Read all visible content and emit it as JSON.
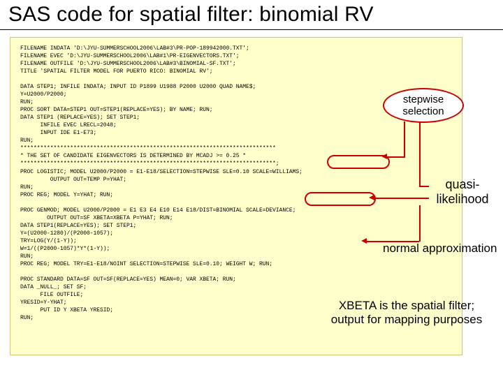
{
  "title": "SAS code for spatial filter: binomial RV",
  "code": "FILENAME INDATA 'D:\\JYU-SUMMERSCHOOL2006\\LAB#3\\PR-POP-189942000.TXT';\nFILENAME EVEC 'D:\\JYU-SUMMERSCHOOL2006\\LAB#1\\PR-EIGENVECTORS.TXT';\nFILENAME OUTFILE 'D:\\JYU-SUMMERSCHOOL2006\\LAB#3\\BINOMIAL-SF.TXT';\nTITLE 'SPATIAL FILTER MODEL FOR PUERTO RICO: BINOMIAL RV';\n\nDATA STEP1; INFILE INDATA; INPUT ID P1899 U1988 P2000 U2000 QUAD NAME$;\nY=U2000/P2000;\nRUN;\nPROC SORT DATA=STEP1 OUT=STEP1(REPLACE=YES); BY NAME; RUN;\nDATA STEP1 (REPLACE=YES); SET STEP1;\n      INFILE EVEC LRECL=2048;\n      INPUT IDE E1-E73;\nRUN;\n*****************************************************************************\n* THE SET OF CANDIDATE EIGENVECTORS IS DETERMINED BY MCADJ >= 0.25 *\n*****************************************************************************;\nPROC LOGISTIC; MODEL U2000/P2000 = E1-E18/SELECTION=STEPWISE SLE=0.10 SCALE=WILLIAMS;\n         OUTPUT OUT=TEMP P=YHAT;\nRUN;\nPROC REG; MODEL Y=YHAT; RUN;\n\nPROC GENMOD; MODEL U2000/P2000 = E1 E3 E4 E10 E14 E18/DIST=BINOMIAL SCALE=DEVIANCE;\n        OUTPUT OUT=SF XBETA=XBETA P=YHAT; RUN;\nDATA STEP1(REPLACE=YES); SET STEP1;\nY=(U2000-1280)/(P2000-1057);\nTRY=LOG(Y/(1-Y));\nW=1/((P2000-1057)*Y*(1-Y));\nRUN;\nPROC REG; MODEL TRY=E1-E18/NOINT SELECTION=STEPWISE SLE=0.10; WEIGHT W; RUN;\n\nPROC STANDARD DATA=SF OUT=SF(REPLACE=YES) MEAN=0; VAR XBETA; RUN;\nDATA _NULL_; SET SF;\n      FILE OUTFILE;\nYRESID=Y-YHAT;\n      PUT ID Y XBETA YRESID;\nRUN;",
  "annotations": {
    "stepwise": "stepwise\nselection",
    "quasi": "quasi-\nlikelihood",
    "normal": "normal approximation",
    "xbeta": "XBETA is the spatial filter;\noutput for mapping purposes"
  }
}
